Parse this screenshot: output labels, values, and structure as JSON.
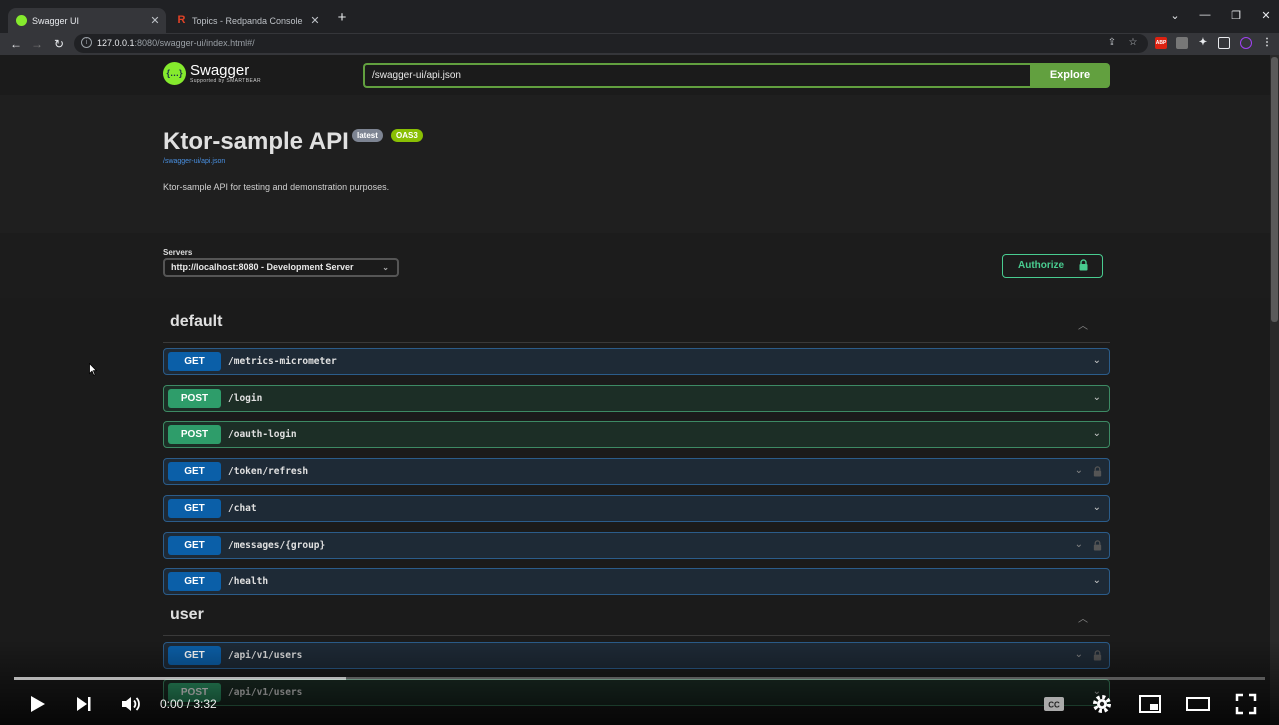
{
  "browser": {
    "tabs": [
      {
        "title": "Swagger UI",
        "active": true
      },
      {
        "title": "Topics - Redpanda Console",
        "active": false
      }
    ],
    "address": {
      "host": "127.0.0.1",
      "rest": ":8080/swagger-ui/index.html#/"
    },
    "extensions": [
      "ABP",
      "ext-2",
      "puzzle",
      "sidebar",
      "profile"
    ]
  },
  "swagger": {
    "logo_text": "Swagger",
    "logo_sub": "Supported by SMARTBEAR",
    "spec_url": "/swagger-ui/api.json",
    "explore_label": "Explore",
    "title": "Ktor-sample API",
    "version_badge": "latest",
    "oas_badge": "OAS3",
    "spec_link": "/swagger-ui/api.json",
    "description": "Ktor-sample API for testing and demonstration purposes.",
    "servers_label": "Servers",
    "server_selected": "http://localhost:8080 - Development Server",
    "authorize_label": "Authorize",
    "sections": [
      {
        "name": "default",
        "ops": [
          {
            "method": "GET",
            "path": "/metrics-micrometer",
            "locked": false
          },
          {
            "method": "POST",
            "path": "/login",
            "locked": false
          },
          {
            "method": "POST",
            "path": "/oauth-login",
            "locked": false
          },
          {
            "method": "GET",
            "path": "/token/refresh",
            "locked": true
          },
          {
            "method": "GET",
            "path": "/chat",
            "locked": false
          },
          {
            "method": "GET",
            "path": "/messages/{group}",
            "locked": true
          },
          {
            "method": "GET",
            "path": "/health",
            "locked": false
          }
        ]
      },
      {
        "name": "user",
        "ops": [
          {
            "method": "GET",
            "path": "/api/v1/users",
            "locked": true
          },
          {
            "method": "POST",
            "path": "/api/v1/users",
            "locked": false
          }
        ]
      }
    ]
  },
  "player": {
    "time": "0:00 / 3:32",
    "played_fraction": 0.0,
    "loaded_fraction": 0.265
  },
  "colors": {
    "get": "#0b5fa8",
    "post": "#2e9d6a",
    "swagger_green": "#62a03f",
    "authorize": "#49cc90"
  }
}
